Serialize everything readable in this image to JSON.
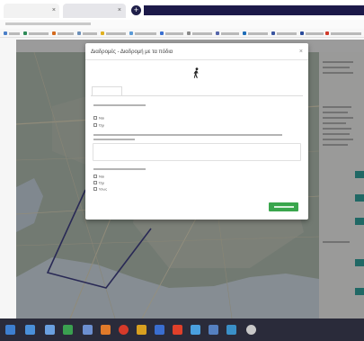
{
  "browser": {
    "tabs": [
      {
        "label": ""
      },
      {
        "label": ""
      }
    ],
    "new_tab_label": "+",
    "tab_close": "×"
  },
  "modal": {
    "title": "Διαδρομές - Διαδρομή με τα πόδια",
    "close": "×",
    "tab_label": "",
    "q1_text": "",
    "q1_options": [
      "Ναι",
      "Όχι"
    ],
    "q2_text": "",
    "q3_text": "",
    "q3_options": [
      "Ναι",
      "Όχι",
      "Ίσως"
    ],
    "submit_label": ""
  },
  "colors": {
    "map_land": "#9aa69a",
    "map_water": "#b8c4cc",
    "route_line": "#2a2a6e",
    "submit_button": "#3aa64d",
    "panel_button": "#1c8a86",
    "taskbar": "#2a2b3a",
    "tab_strip_dark": "#1d1a4a"
  },
  "icons": {
    "walker": "person-walking-icon",
    "close": "close-icon",
    "new_tab": "plus-icon"
  }
}
